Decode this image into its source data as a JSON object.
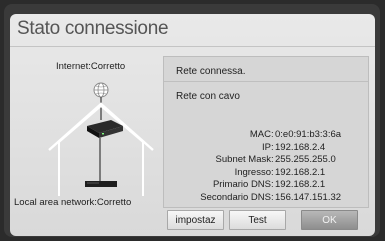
{
  "dialog": {
    "title": "Stato connessione",
    "internet_label": "Internet:Corretto",
    "lan_label": "Local area network:Corretto",
    "status": "Rete connessa.",
    "connection_type": "Rete con cavo",
    "details": [
      {
        "key": "MAC",
        "value": "0:e0:91:b3:3:6a"
      },
      {
        "key": "IP",
        "value": "192.168.2.4"
      },
      {
        "key": "Subnet Mask",
        "value": "255.255.255.0"
      },
      {
        "key": "Ingresso",
        "value": "192.168.2.1"
      },
      {
        "key": "Primario DNS",
        "value": "192.168.2.1"
      },
      {
        "key": "Secondario DNS",
        "value": "156.147.151.32"
      }
    ],
    "buttons": {
      "settings": "impostaz",
      "test": "Test",
      "ok": "OK"
    },
    "colors": {
      "selected_button": "#9a9a9a",
      "dialog_bg": "#e2e2e2",
      "panel_bg": "#d6d6d6"
    }
  }
}
